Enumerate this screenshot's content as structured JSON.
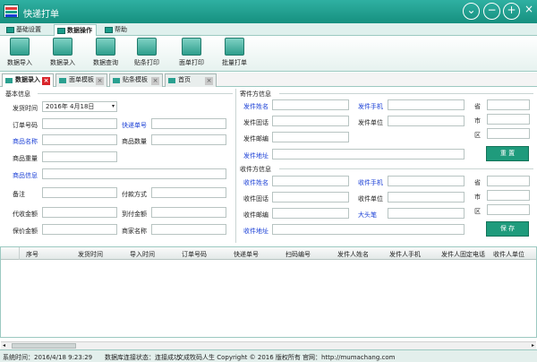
{
  "app": {
    "title": "快递打单",
    "window_buttons": [
      "chevron-down-icon",
      "minimize-icon",
      "maximize-icon",
      "close-icon"
    ]
  },
  "menu": {
    "tabs": [
      {
        "label": "基础设置"
      },
      {
        "label": "数据操作",
        "active": true
      },
      {
        "label": "帮助"
      }
    ]
  },
  "toolbar": {
    "buttons": [
      {
        "label": "数据导入",
        "icon": "import-icon"
      },
      {
        "label": "数据录入",
        "icon": "edit-icon"
      },
      {
        "label": "数据查询",
        "icon": "database-icon"
      },
      {
        "label": "贴条打印",
        "icon": "stack-print-icon"
      },
      {
        "label": "面单打印",
        "icon": "form-print-icon"
      },
      {
        "label": "批量打单",
        "icon": "batch-print-icon"
      }
    ]
  },
  "doc_tabs": [
    {
      "label": "数据录入",
      "active": true
    },
    {
      "label": "面单模板"
    },
    {
      "label": "贴条模板"
    },
    {
      "label": "首页"
    }
  ],
  "basic_info": {
    "section_title": "基本信息",
    "ship_time_label": "发货时间",
    "ship_time_value": "2016年  4月18日",
    "order_no_label": "订单号码",
    "express_no_label": "快递单号",
    "product_name_label": "商品名称",
    "product_qty_label": "商品数量",
    "product_weight_label": "商品重量",
    "product_info_label": "商品信息",
    "remark_label": "备注",
    "payment_label": "付款方式",
    "cod_label": "代收金额",
    "arrival_pay_label": "到付金额",
    "insured_label": "保价金额",
    "merchant_label": "商家名称"
  },
  "sender": {
    "section_title": "寄件方信息",
    "name_label": "发件姓名",
    "mobile_label": "发件手机",
    "phone_label": "发件固话",
    "company_label": "发件单位",
    "postcode_label": "发件邮编",
    "address_label": "发件地址",
    "province_label": "省",
    "city_label": "市",
    "district_label": "区",
    "reset_button": "重 置"
  },
  "receiver": {
    "section_title": "收件方信息",
    "name_label": "收件姓名",
    "mobile_label": "收件手机",
    "phone_label": "收件固话",
    "company_label": "收件单位",
    "postcode_label": "收件邮编",
    "bigpen_label": "大头笔",
    "address_label": "收件地址",
    "province_label": "省",
    "city_label": "市",
    "district_label": "区",
    "save_button": "保 存"
  },
  "grid": {
    "columns": [
      "序号",
      "发货时间",
      "导入时间",
      "订单号码",
      "快递单号",
      "扫码编号",
      "发件人姓名",
      "发件人手机",
      "发件人固定电话",
      "收件人单位"
    ]
  },
  "status": {
    "time": "系统时间：2016/4/18 9:23:29",
    "db_status": "数据库连接状态：连接成功",
    "copyright": "文成牧码人生 Copyright © 2016 版权所有",
    "website": "官网：http://mumachang.com"
  },
  "colors": {
    "accent": "#1a9b89",
    "title_bar": "#16907f",
    "link_blue": "#1a3fd6",
    "button_green": "#1f9b7c",
    "tab_close_red": "#d9252a"
  }
}
